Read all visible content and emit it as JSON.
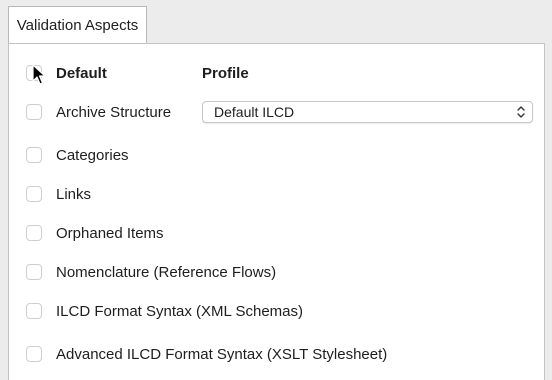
{
  "tabs": [
    {
      "label": "Validation Aspects"
    }
  ],
  "header": {
    "default_label": "Default",
    "profile_label": "Profile"
  },
  "profile_select": {
    "value": "Default ILCD"
  },
  "aspects": [
    {
      "label": "Archive Structure",
      "checked": false
    },
    {
      "label": "Categories",
      "checked": false
    },
    {
      "label": "Links",
      "checked": false
    },
    {
      "label": "Orphaned Items",
      "checked": false
    },
    {
      "label": "Nomenclature (Reference Flows)",
      "checked": false
    },
    {
      "label": "ILCD Format Syntax (XML Schemas)",
      "checked": false
    },
    {
      "label": "Advanced ILCD Format Syntax (XSLT Stylesheet)",
      "checked": false
    }
  ]
}
